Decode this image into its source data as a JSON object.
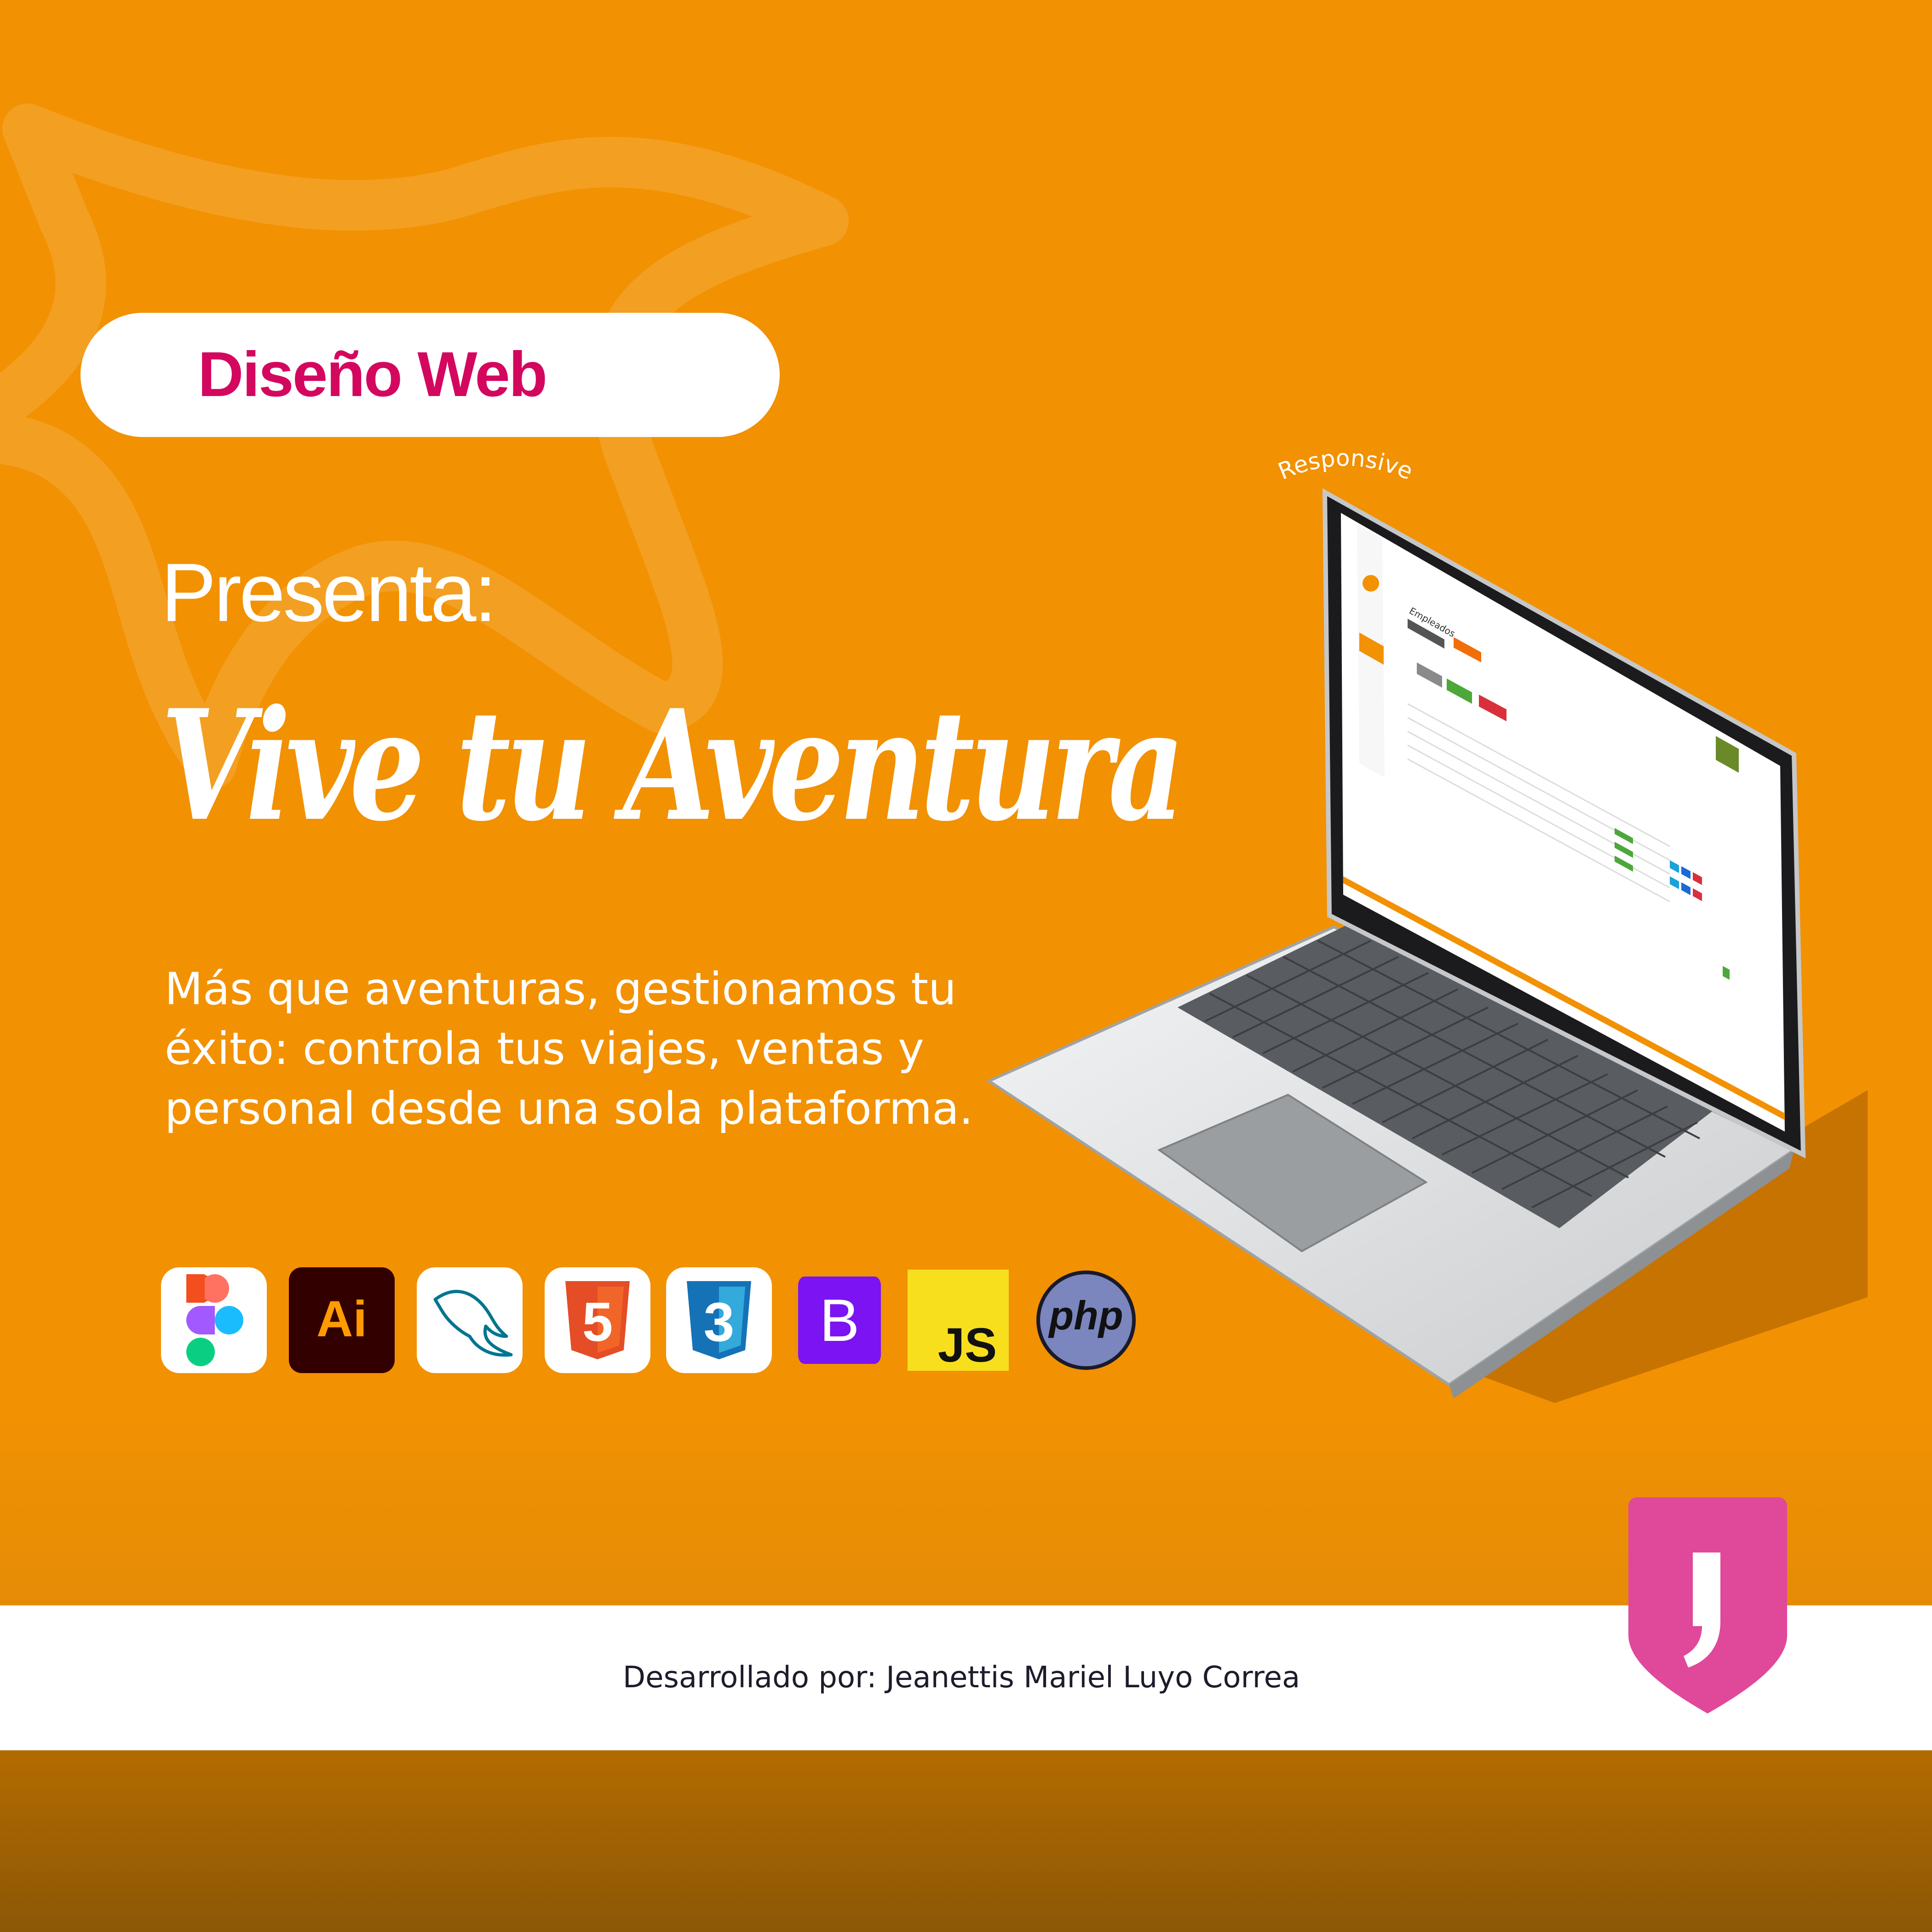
{
  "badge": {
    "label": "Diseño Web"
  },
  "presenta": "Presenta:",
  "title": "Vive tu Aventura",
  "description": "Más que aventuras, gestionamos tu éxito: controla tus viajes, ventas y personal desde una sola plataforma.",
  "tag": "Responsive",
  "tech_icons": [
    {
      "icon": "figma-icon"
    },
    {
      "icon": "illustrator-icon",
      "label": "Ai"
    },
    {
      "icon": "mysql-icon"
    },
    {
      "icon": "html5-icon",
      "label": "5"
    },
    {
      "icon": "css3-icon",
      "label": "3"
    },
    {
      "icon": "bootstrap-icon",
      "label": "B"
    },
    {
      "icon": "javascript-icon",
      "label": "JS"
    },
    {
      "icon": "php-icon",
      "label": "php"
    }
  ],
  "screen": {
    "heading": "Empleados"
  },
  "credit": "Desarrollado por: Jeanettis Mariel Luyo Correa",
  "colors": {
    "background": "#f29102",
    "badge_text": "#d4075f",
    "footer": "#ffffff",
    "bottom_band": "#a0650a",
    "logo": "#e0489a"
  }
}
